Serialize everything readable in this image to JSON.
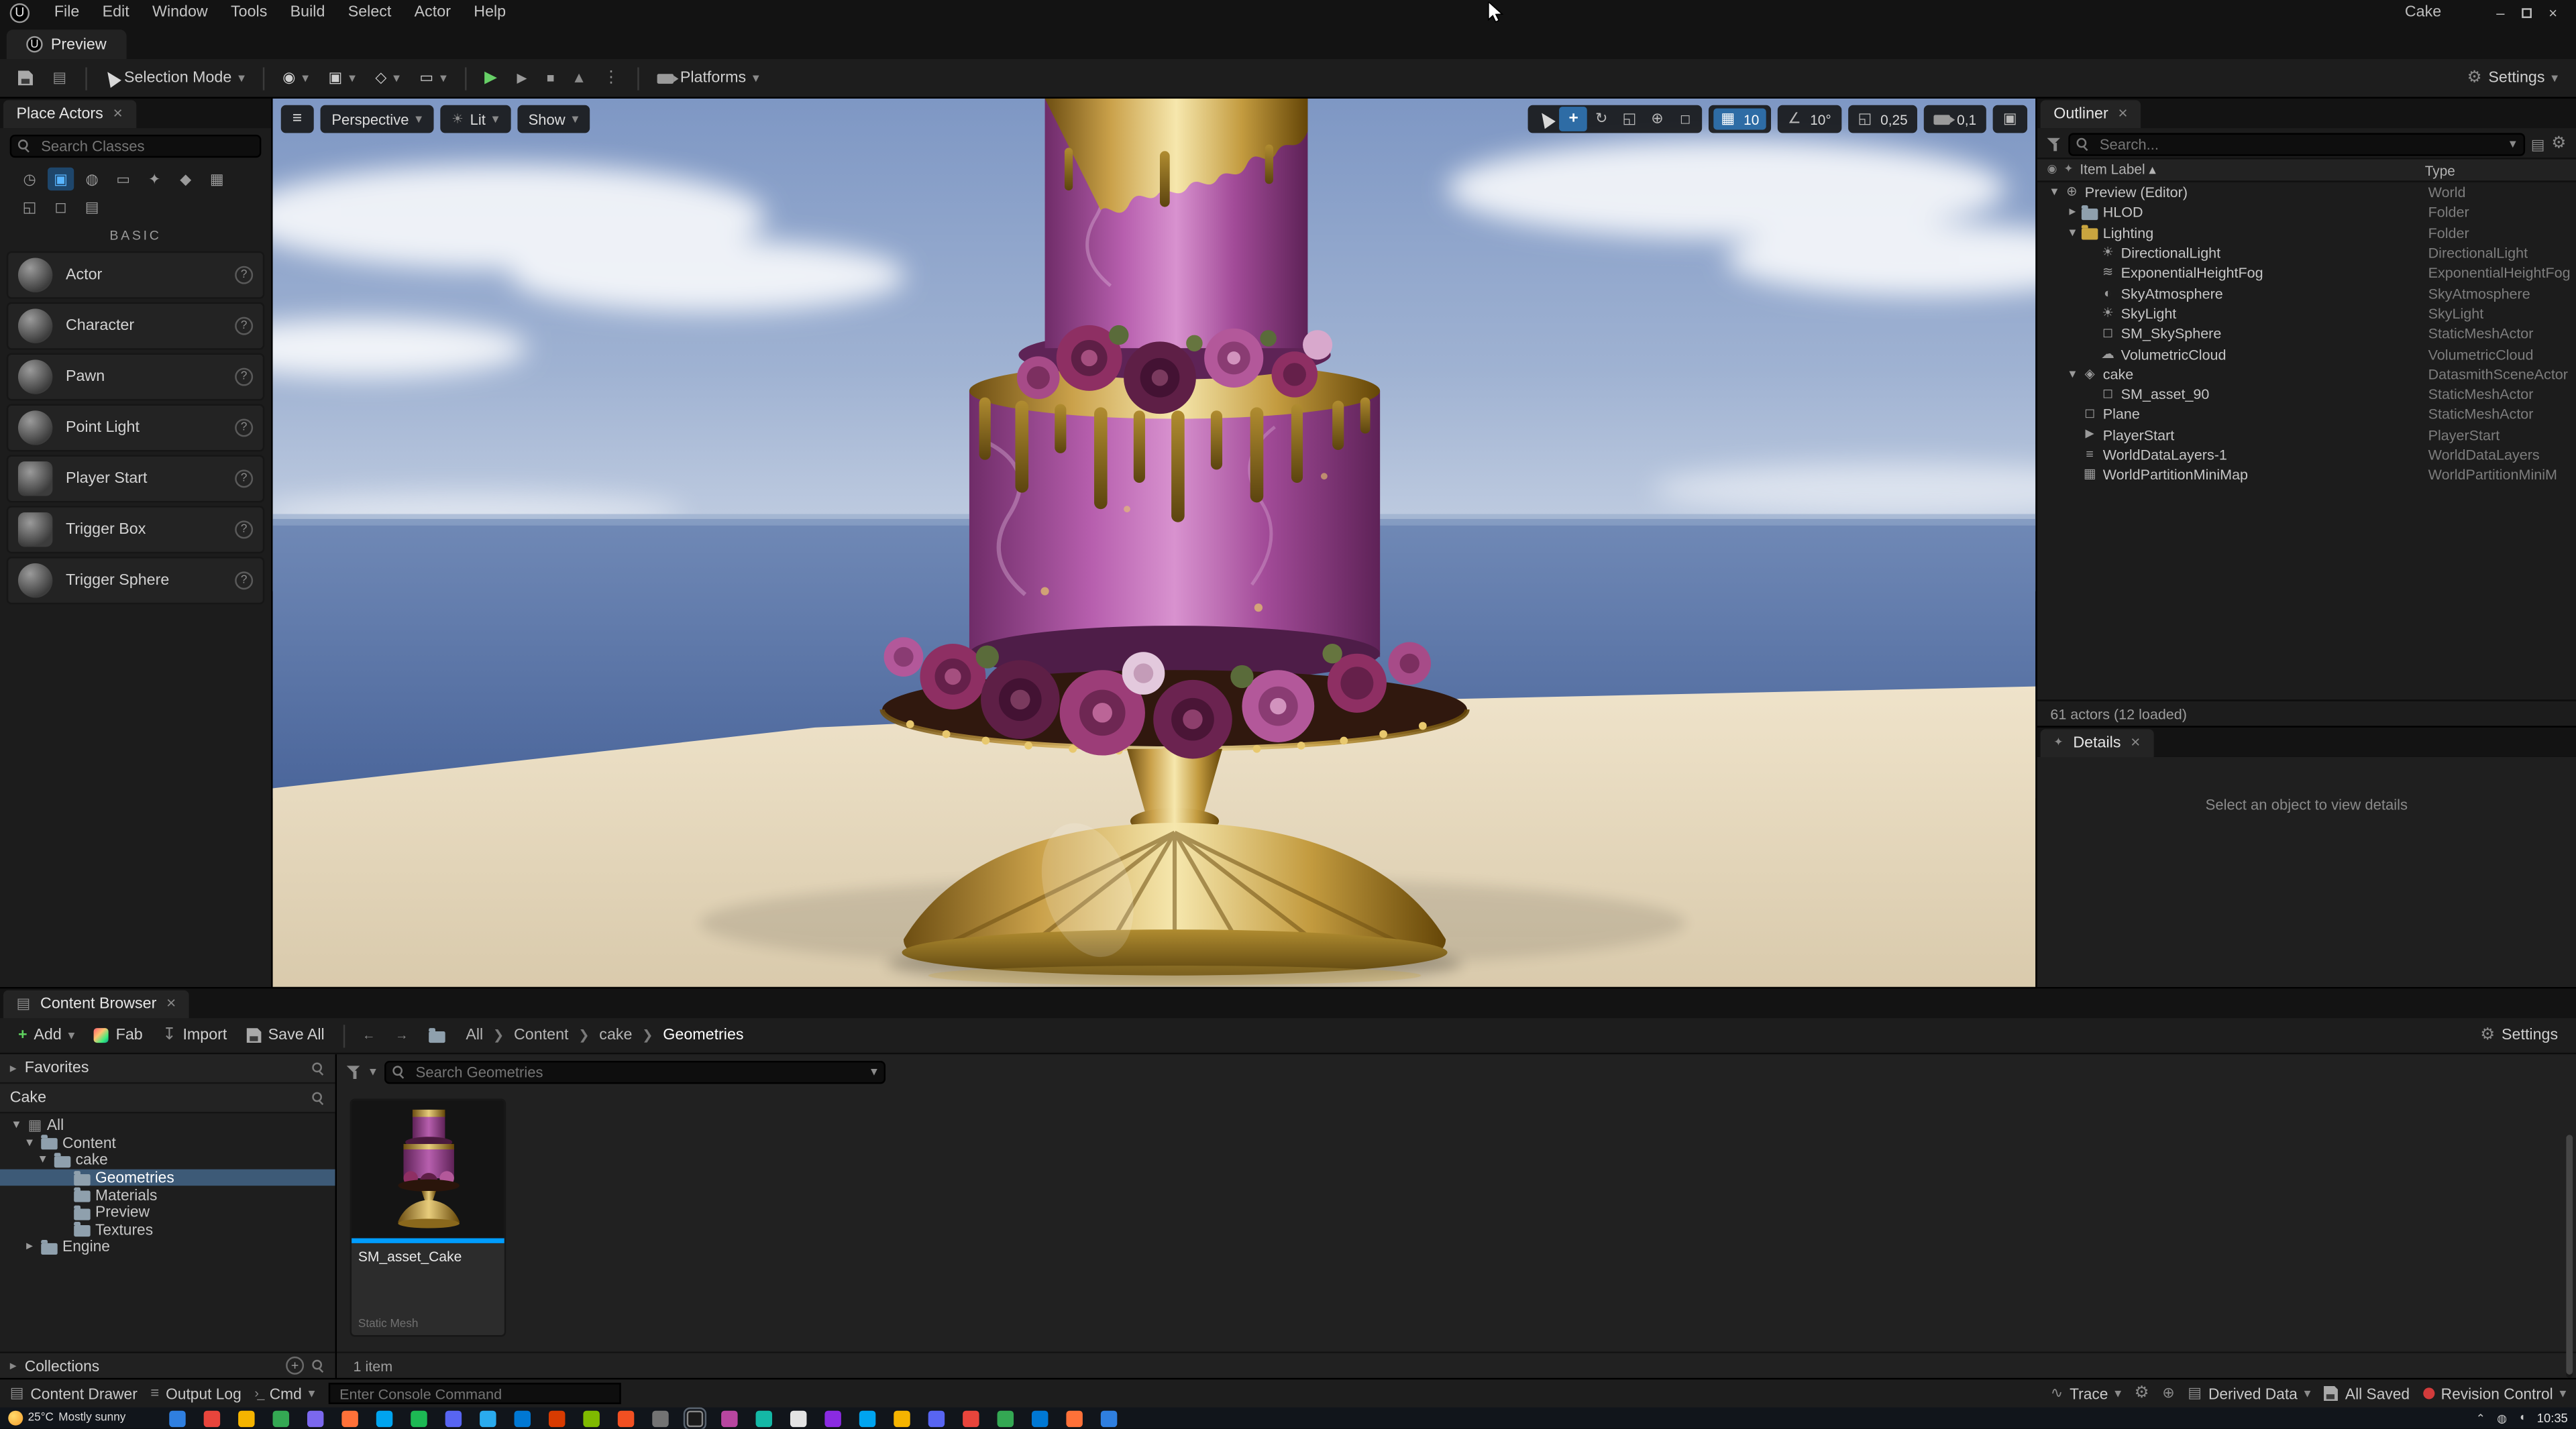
{
  "window": {
    "project": "Cake"
  },
  "menu": {
    "items": [
      "File",
      "Edit",
      "Window",
      "Tools",
      "Build",
      "Select",
      "Actor",
      "Help"
    ]
  },
  "tabs": {
    "preview": "Preview"
  },
  "main_toolbar": {
    "selection_mode": "Selection Mode",
    "platforms": "Platforms",
    "settings": "Settings"
  },
  "place_actors": {
    "title": "Place Actors",
    "search_placeholder": "Search Classes",
    "section_label": "BASIC",
    "items": [
      "Actor",
      "Character",
      "Pawn",
      "Point Light",
      "Player Start",
      "Trigger Box",
      "Trigger Sphere"
    ]
  },
  "viewport": {
    "perspective": "Perspective",
    "lit": "Lit",
    "show": "Show",
    "grid_snap": "10",
    "rot_snap": "10°",
    "scale_snap": "0,25",
    "cam_speed": "0,1"
  },
  "outliner": {
    "title": "Outliner",
    "search_placeholder": "Search...",
    "columns": [
      "Item Label",
      "Type"
    ],
    "rows": [
      {
        "label": "Preview (Editor)",
        "type": "World"
      },
      {
        "label": "HLOD",
        "type": "Folder"
      },
      {
        "label": "Lighting",
        "type": "Folder"
      },
      {
        "label": "DirectionalLight",
        "type": "DirectionalLight"
      },
      {
        "label": "ExponentialHeightFog",
        "type": "ExponentialHeightFog"
      },
      {
        "label": "SkyAtmosphere",
        "type": "SkyAtmosphere"
      },
      {
        "label": "SkyLight",
        "type": "SkyLight"
      },
      {
        "label": "SM_SkySphere",
        "type": "StaticMeshActor"
      },
      {
        "label": "VolumetricCloud",
        "type": "VolumetricCloud"
      },
      {
        "label": "cake",
        "type": "DatasmithSceneActor"
      },
      {
        "label": "SM_asset_90",
        "type": "StaticMeshActor"
      },
      {
        "label": "Plane",
        "type": "StaticMeshActor"
      },
      {
        "label": "PlayerStart",
        "type": "PlayerStart"
      },
      {
        "label": "WorldDataLayers-1",
        "type": "WorldDataLayers"
      },
      {
        "label": "WorldPartitionMiniMap",
        "type": "WorldPartitionMiniM"
      }
    ],
    "status": "61 actors (12 loaded)"
  },
  "details": {
    "title": "Details",
    "empty_message": "Select an object to view details"
  },
  "content_browser": {
    "tab": "Content Browser",
    "toolbar": {
      "add": "Add",
      "fab": "Fab",
      "import": "Import",
      "save_all": "Save All",
      "settings": "Settings"
    },
    "breadcrumb": [
      "All",
      "Content",
      "cake",
      "Geometries"
    ],
    "favorites_title": "Favorites",
    "sources_title": "Cake",
    "tree": [
      {
        "label": "All"
      },
      {
        "label": "Content"
      },
      {
        "label": "cake"
      },
      {
        "label": "Geometries"
      },
      {
        "label": "Materials"
      },
      {
        "label": "Preview"
      },
      {
        "label": "Textures"
      },
      {
        "label": "Engine"
      }
    ],
    "collections_title": "Collections",
    "search_placeholder": "Search Geometries",
    "assets": [
      {
        "name": "SM_asset_Cake",
        "type": "Static Mesh"
      }
    ],
    "status": "1 item"
  },
  "status_bar": {
    "content_drawer": "Content Drawer",
    "output_log": "Output Log",
    "cmd": "Cmd",
    "console_placeholder": "Enter Console Command",
    "trace": "Trace",
    "derived_data": "Derived Data",
    "all_saved": "All Saved",
    "revision_control": "Revision Control"
  },
  "taskbar": {
    "time": "10:35",
    "weather_temp": "25°C",
    "weather_desc": "Mostly sunny"
  }
}
